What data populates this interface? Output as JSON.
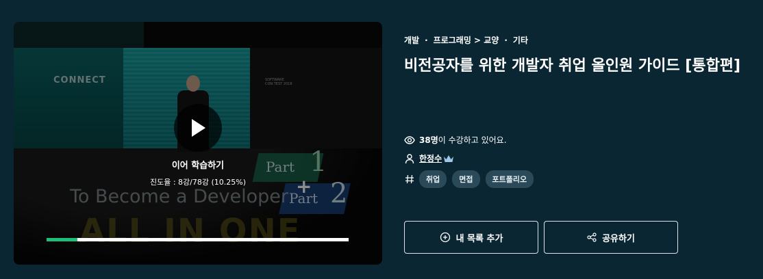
{
  "video": {
    "resume_label": "이어 학습하기",
    "progress_text": "진도율 : 8강/78강 (10.25%)",
    "progress_fraction": 0.1025,
    "thumbnail_texts": {
      "connect": "CONNECT",
      "software_line1": "SOFTWARE",
      "software_line2": "CON.TEST 2018",
      "become": "To Become a Developer",
      "all_in_one": "ALL IN ONE",
      "part1": "Part",
      "part1_num": "1",
      "part2": "Part",
      "part2_num": "2",
      "plus": "+"
    }
  },
  "course": {
    "breadcrumb": {
      "category1": "개발",
      "sep1": "·",
      "category2": "프로그래밍 > 교양",
      "sep2": "·",
      "category3": "기타"
    },
    "title": "비전공자를 위한 개발자 취업 올인원 가이드 [통합편]",
    "students_count": "38명",
    "students_suffix": "이 수강하고 있어요.",
    "instructor": "한정수",
    "tags": [
      "취업",
      "면접",
      "포트폴리오"
    ]
  },
  "actions": {
    "add_to_list": "내 목록 추가",
    "share": "공유하기"
  },
  "colors": {
    "background": "#0b2633",
    "progress_fill": "#1dc078",
    "tag_bg": "#2a4a5a",
    "crown": "#9fc8e8"
  },
  "icons": {
    "play": "play-icon",
    "eye": "eye-icon",
    "person": "person-icon",
    "crown": "crown-icon",
    "hash": "hash-icon",
    "plus_circle": "plus-circle-icon",
    "share": "share-icon"
  }
}
